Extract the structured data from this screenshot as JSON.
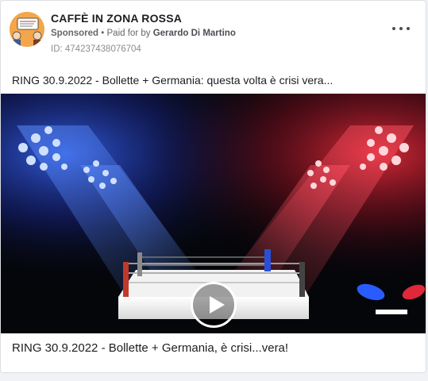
{
  "post": {
    "page_name": "CAFFÈ IN ZONA ROSSA",
    "sponsored_label": "Sponsored",
    "separator": "•",
    "paid_for_prefix": "Paid for by",
    "payer": "Gerardo Di Martino",
    "id_text": "ID: 474237438076704",
    "more_icon": "ellipsis-icon",
    "text": "RING 30.9.2022 - Bollette + Germania: questa volta è crisi vera...",
    "caption": "RING 30.9.2022 - Bollette + Germania, è crisi...vera!"
  },
  "video": {
    "play_icon": "play-icon",
    "left_light_color": "#2a6bff",
    "right_light_color": "#ff2a3a"
  },
  "colors": {
    "text_primary": "#1c1e21",
    "text_secondary": "#65676b",
    "avatar_bg": "#f3a64a"
  }
}
